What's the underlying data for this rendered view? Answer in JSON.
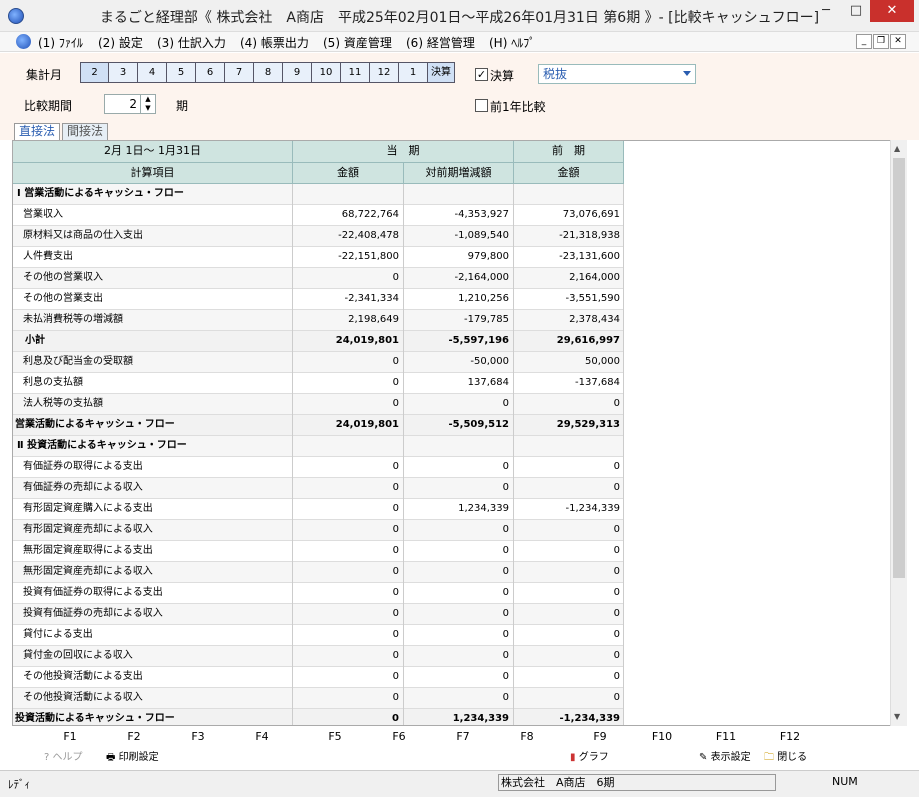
{
  "window": {
    "title": "まるごと経理部《 株式会社　A商店　平成25年02月01日～平成26年01月31日 第6期 》- [比較キャッシュフロー]",
    "min": "─",
    "max": "□",
    "close": "✕"
  },
  "menu": {
    "items": [
      "(1) ﾌｧｲﾙ",
      "(2) 設定",
      "(3) 仕訳入力",
      "(4) 帳票出力",
      "(5) 資産管理",
      "(6) 経営管理",
      "(H) ﾍﾙﾌﾟ"
    ]
  },
  "form": {
    "period_label": "集計月",
    "months": [
      "2",
      "3",
      "4",
      "5",
      "6",
      "7",
      "8",
      "9",
      "10",
      "11",
      "12",
      "1",
      "決算"
    ],
    "settlement_label": "決算",
    "settlement_checked": "✓",
    "tax_select": "税抜",
    "compare_label": "比較期間",
    "compare_value": "2",
    "compare_unit": "期",
    "prev_year_label": "前1年比較"
  },
  "tabs": [
    "直接法",
    "間接法"
  ],
  "table": {
    "header_period": "2月 1日～ 1月31日",
    "header_current": "当　期",
    "header_prev": "前　期",
    "col_item": "計算項目",
    "col_amount": "金額",
    "col_diff": "対前期増減額",
    "col_prev_amount": "金額",
    "rows": [
      {
        "type": "section",
        "label": "Ⅰ 営業活動によるキャッシュ・フロー",
        "cur": "",
        "diff": "",
        "prev": ""
      },
      {
        "type": "item",
        "label": "営業収入",
        "cur": "68,722,764",
        "diff": "-4,353,927",
        "prev": "73,076,691"
      },
      {
        "type": "item",
        "label": "原材料又は商品の仕入支出",
        "cur": "-22,408,478",
        "diff": "-1,089,540",
        "prev": "-21,318,938"
      },
      {
        "type": "item",
        "label": "人件費支出",
        "cur": "-22,151,800",
        "diff": "979,800",
        "prev": "-23,131,600"
      },
      {
        "type": "item",
        "label": "その他の営業収入",
        "cur": "0",
        "diff": "-2,164,000",
        "prev": "2,164,000"
      },
      {
        "type": "item",
        "label": "その他の営業支出",
        "cur": "-2,341,334",
        "diff": "1,210,256",
        "prev": "-3,551,590"
      },
      {
        "type": "item",
        "label": "未払消費税等の増減額",
        "cur": "2,198,649",
        "diff": "-179,785",
        "prev": "2,378,434"
      },
      {
        "type": "subtotal",
        "label": "小計",
        "cur": "24,019,801",
        "diff": "-5,597,196",
        "prev": "29,616,997"
      },
      {
        "type": "item",
        "label": "利息及び配当金の受取額",
        "cur": "0",
        "diff": "-50,000",
        "prev": "50,000"
      },
      {
        "type": "item",
        "label": "利息の支払額",
        "cur": "0",
        "diff": "137,684",
        "prev": "-137,684"
      },
      {
        "type": "item",
        "label": "法人税等の支払額",
        "cur": "0",
        "diff": "0",
        "prev": "0"
      },
      {
        "type": "total",
        "label": "営業活動によるキャッシュ・フロー",
        "cur": "24,019,801",
        "diff": "-5,509,512",
        "prev": "29,529,313"
      },
      {
        "type": "section",
        "label": "Ⅱ 投資活動によるキャッシュ・フロー",
        "cur": "",
        "diff": "",
        "prev": ""
      },
      {
        "type": "item",
        "label": "有価証券の取得による支出",
        "cur": "0",
        "diff": "0",
        "prev": "0"
      },
      {
        "type": "item",
        "label": "有価証券の売却による収入",
        "cur": "0",
        "diff": "0",
        "prev": "0"
      },
      {
        "type": "item",
        "label": "有形固定資産購入による支出",
        "cur": "0",
        "diff": "1,234,339",
        "prev": "-1,234,339"
      },
      {
        "type": "item",
        "label": "有形固定資産売却による収入",
        "cur": "0",
        "diff": "0",
        "prev": "0"
      },
      {
        "type": "item",
        "label": "無形固定資産取得による支出",
        "cur": "0",
        "diff": "0",
        "prev": "0"
      },
      {
        "type": "item",
        "label": "無形固定資産売却による収入",
        "cur": "0",
        "diff": "0",
        "prev": "0"
      },
      {
        "type": "item",
        "label": "投資有価証券の取得による支出",
        "cur": "0",
        "diff": "0",
        "prev": "0"
      },
      {
        "type": "item",
        "label": "投資有価証券の売却による収入",
        "cur": "0",
        "diff": "0",
        "prev": "0"
      },
      {
        "type": "item",
        "label": "貸付による支出",
        "cur": "0",
        "diff": "0",
        "prev": "0"
      },
      {
        "type": "item",
        "label": "貸付金の回収による収入",
        "cur": "0",
        "diff": "0",
        "prev": "0"
      },
      {
        "type": "item",
        "label": "その他投資活動による支出",
        "cur": "0",
        "diff": "0",
        "prev": "0"
      },
      {
        "type": "item",
        "label": "その他投資活動による収入",
        "cur": "0",
        "diff": "0",
        "prev": "0"
      },
      {
        "type": "total",
        "label": "投資活動によるキャッシュ・フロー",
        "cur": "0",
        "diff": "1,234,339",
        "prev": "-1,234,339"
      }
    ]
  },
  "fkeys": {
    "labels": [
      "F1",
      "F2",
      "F3",
      "F4",
      "F5",
      "F6",
      "F7",
      "F8",
      "F9",
      "F10",
      "F11",
      "F12"
    ],
    "help": "ヘルプ",
    "print_settings": "印刷設定",
    "graph": "グラフ",
    "display_settings": "表示設定",
    "close": "閉じる"
  },
  "status": {
    "ready": "ﾚﾃﾞｨ",
    "company": "株式会社　A商店　6期",
    "num": "NUM"
  }
}
